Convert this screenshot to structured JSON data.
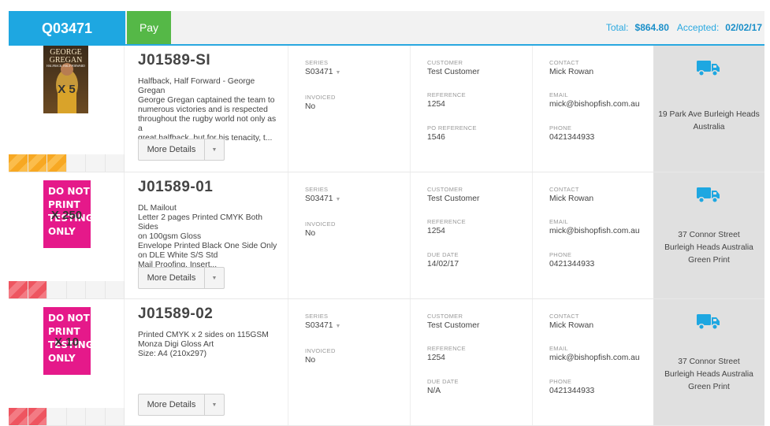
{
  "header": {
    "quote_id": "Q03471",
    "pay_label": "Pay",
    "total_label": "Total:",
    "total_value": "$864.80",
    "accepted_label": "Accepted:",
    "accepted_value": "02/02/17",
    "accent_color": "#1ea7e1",
    "pay_color": "#55b847"
  },
  "labels": {
    "series": "SERIES",
    "invoiced": "INVOICED",
    "customer": "CUSTOMER",
    "reference": "REFERENCE",
    "po_reference": "PO REFERENCE",
    "due_date": "DUE DATE",
    "contact": "CONTACT",
    "email": "EMAIL",
    "phone": "PHONE",
    "more_details": "More Details"
  },
  "jobs": [
    {
      "thumb": "George Gregan book cover",
      "thumb_lines": [
        "GEORGE",
        "GREGAN",
        "HALFBACK, HALF FORWARD"
      ],
      "qty": "X 5",
      "progress_color": "orange",
      "progress_filled": 0.5,
      "job_no": "J01589-SI",
      "description": "Halfback, Half Forward - George Gregan\nGeorge Gregan captained the team to\nnumerous victories and is respected\nthroughout the rugby world not only as a\ngreat halfback, but for his tenacity, t...",
      "series": "S03471",
      "invoiced": "No",
      "customer": "Test Customer",
      "reference": "1254",
      "third_label": "PO REFERENCE",
      "third_value": "1546",
      "contact": "Mick Rowan",
      "email": "mick@bishopfish.com.au",
      "phone": "0421344933",
      "address": "19 Park Ave Burleigh Heads Australia"
    },
    {
      "thumb": "DO NOT PRINT TESTING ONLY",
      "dnp_lines": [
        "DO NOT",
        "PRINT",
        "TESTING",
        "ONLY"
      ],
      "qty": "X 250",
      "progress_color": "red",
      "progress_filled": 0.33,
      "job_no": "J01589-01",
      "description": "DL Mailout\nLetter 2 pages Printed CMYK Both Sides\non 100gsm Gloss\nEnvelope Printed Black One Side Only\non DLE White S/S Std\nMail Proofing, Insert...",
      "series": "S03471",
      "invoiced": "No",
      "customer": "Test Customer",
      "reference": "1254",
      "third_label": "DUE DATE",
      "third_value": "14/02/17",
      "contact": "Mick Rowan",
      "email": "mick@bishopfish.com.au",
      "phone": "0421344933",
      "address": "37 Connor Street\nBurleigh Heads Australia\nGreen Print"
    },
    {
      "thumb": "DO NOT PRINT TESTING ONLY",
      "dnp_lines": [
        "DO NOT",
        "PRINT",
        "TESTING",
        "ONLY"
      ],
      "qty": "X 10",
      "progress_color": "red",
      "progress_filled": 0.33,
      "job_no": "J01589-02",
      "description": "Printed CMYK x 2 sides  on 115GSM\nMonza Digi Gloss Art\nSize: A4 (210x297)",
      "series": "S03471",
      "invoiced": "No",
      "customer": "Test Customer",
      "reference": "1254",
      "third_label": "DUE DATE",
      "third_value": "N/A",
      "contact": "Mick Rowan",
      "email": "mick@bishopfish.com.au",
      "phone": "0421344933",
      "address": "37 Connor Street\nBurleigh Heads Australia\nGreen Print"
    }
  ]
}
